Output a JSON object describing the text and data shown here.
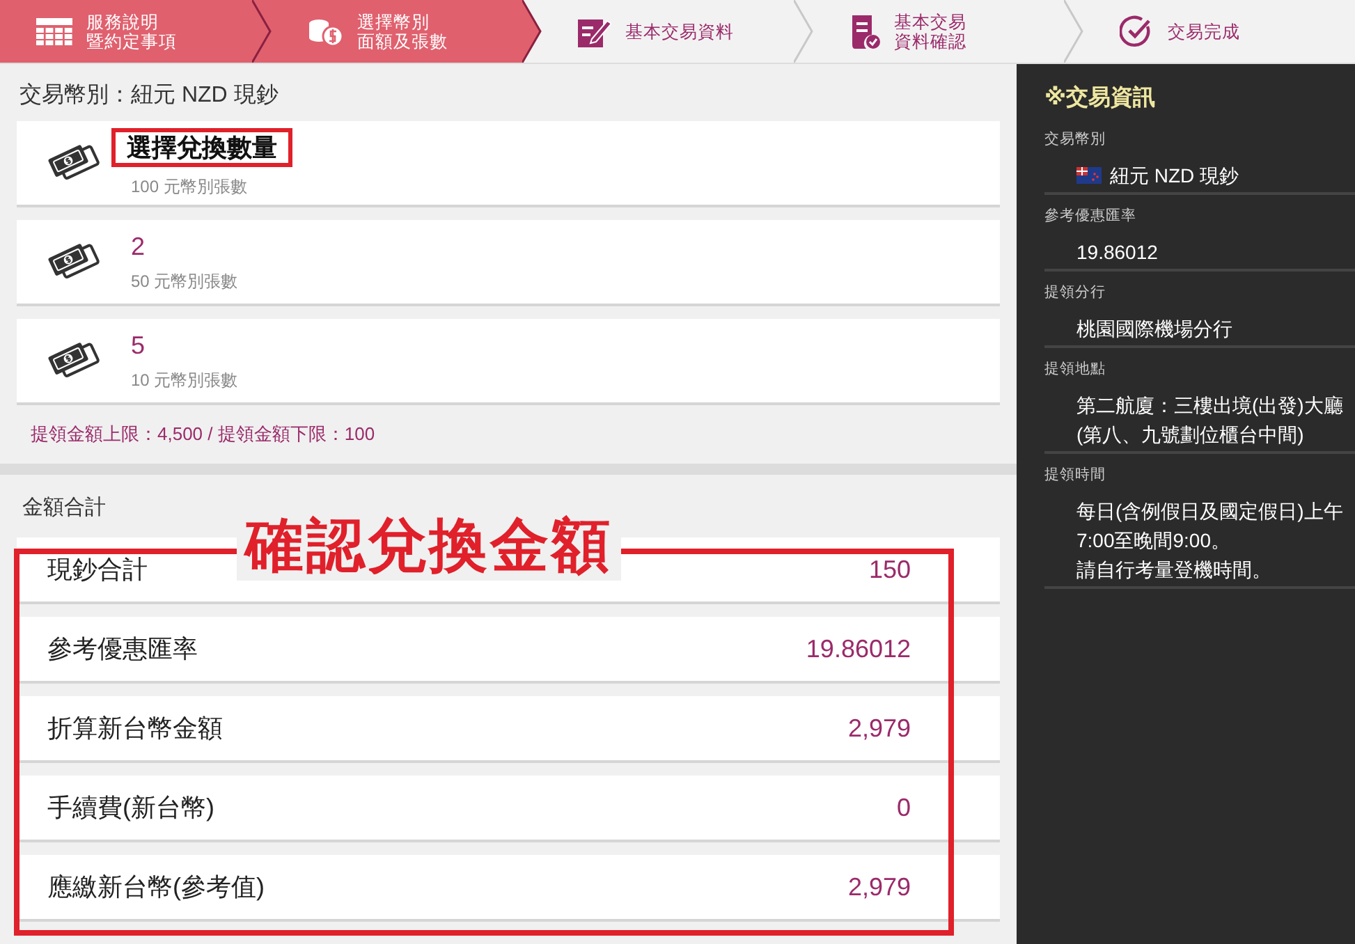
{
  "steps": [
    {
      "lines": [
        "服務說明",
        "暨約定事項"
      ],
      "done": true
    },
    {
      "lines": [
        "選擇幣別",
        "面額及張數"
      ],
      "done": true
    },
    {
      "lines": [
        "基本交易資料"
      ],
      "done": false
    },
    {
      "lines": [
        "基本交易",
        "資料確認"
      ],
      "done": false
    },
    {
      "lines": [
        "交易完成"
      ],
      "done": false
    }
  ],
  "currency_heading": "交易幣別：紐元 NZD 現鈔",
  "denominations": [
    {
      "callout": "選擇兌換數量",
      "caption": "100 元幣別張數"
    },
    {
      "value": "2",
      "caption": "50 元幣別張數"
    },
    {
      "value": "5",
      "caption": "10 元幣別張數"
    }
  ],
  "limit_note": "提領金額上限：4,500 / 提領金額下限：100",
  "summary": {
    "title": "金額合計",
    "callout": "確認兌換金額",
    "rows": [
      {
        "label": "現鈔合計",
        "value": "150"
      },
      {
        "label": "參考優惠匯率",
        "value": "19.86012"
      },
      {
        "label": "折算新台幣金額",
        "value": "2,979"
      },
      {
        "label": "手續費(新台幣)",
        "value": "0"
      },
      {
        "label": "應繳新台幣(參考值)",
        "value": "2,979"
      }
    ]
  },
  "sidebar": {
    "title": "※交易資訊",
    "fields": [
      {
        "label": "交易幣別",
        "lines": [
          "紐元 NZD 現鈔"
        ]
      },
      {
        "label": "參考優惠匯率",
        "lines": [
          "19.86012"
        ]
      },
      {
        "label": "提領分行",
        "lines": [
          "桃園國際機場分行"
        ]
      },
      {
        "label": "提領地點",
        "lines": [
          "第二航廈：三樓出境(出發)大廳",
          "(第八、九號劃位櫃台中間)"
        ]
      },
      {
        "label": "提領時間",
        "lines": [
          "每日(含例假日及國定假日)上午",
          "7:00至晚間9:00。",
          "請自行考量登機時間。"
        ]
      }
    ]
  }
}
